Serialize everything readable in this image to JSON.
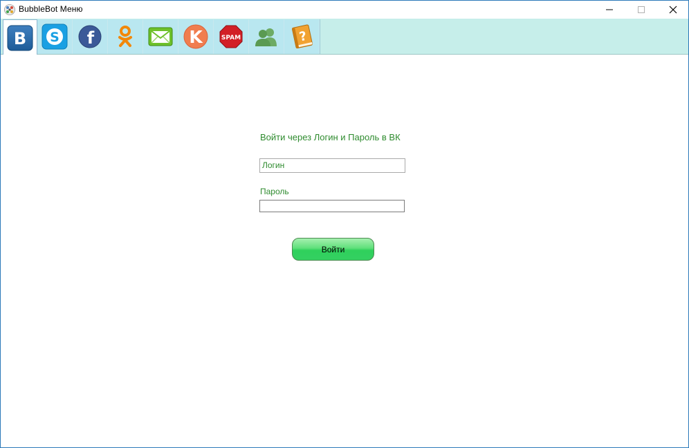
{
  "window": {
    "title": "BubbleBot Меню",
    "accent_color": "#2b78b8"
  },
  "toolbar": {
    "background_color": "#c6eeea",
    "tabs": [
      {
        "icon": "vk-icon",
        "label": "В",
        "active": true
      },
      {
        "icon": "skype-icon",
        "label": "S"
      },
      {
        "icon": "facebook-icon",
        "label": "f"
      },
      {
        "icon": "odnoklassniki-icon"
      },
      {
        "icon": "mail-icon"
      },
      {
        "icon": "kontakt-icon",
        "label": "K"
      },
      {
        "icon": "spam-icon",
        "label": "SPAM"
      },
      {
        "icon": "users-icon"
      },
      {
        "icon": "help-book-icon",
        "label": "?"
      }
    ]
  },
  "login": {
    "heading": "Войти через Логин и Пароль в ВК",
    "login_value": "Логин",
    "password_label": "Пароль",
    "password_value": "",
    "submit_label": "Войти",
    "text_color": "#2e8b2e",
    "button_color": "#34d061"
  }
}
